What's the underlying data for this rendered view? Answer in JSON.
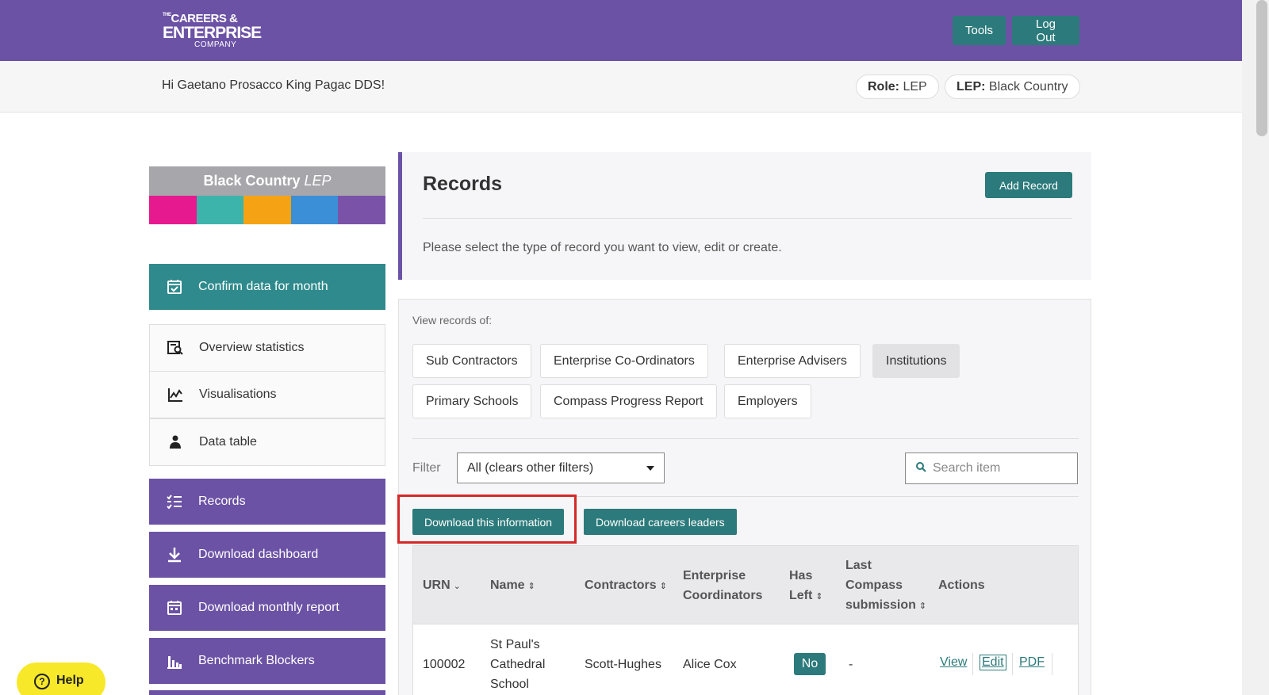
{
  "header": {
    "logo": {
      "the": "THE",
      "line1": "CAREERS &",
      "line2": "ENTERPRISE",
      "line3": "COMPANY"
    },
    "tools_label": "Tools",
    "logout_label": "Log Out"
  },
  "subheader": {
    "greeting": "Hi Gaetano Prosacco King Pagac DDS!",
    "role_key": "Role:",
    "role_value": "LEP",
    "lep_key": "LEP:",
    "lep_value": "Black Country"
  },
  "sidebar": {
    "lep_logo": {
      "name": "Black Country",
      "suffix": "LEP",
      "stripe_colors": [
        "#e6198f",
        "#3cb4ac",
        "#f5a314",
        "#3b8fd6",
        "#7a53a8"
      ]
    },
    "confirm_label": "Confirm data for month",
    "items": [
      {
        "label": "Overview statistics",
        "icon": "overview-stats-icon"
      },
      {
        "label": "Visualisations",
        "icon": "chart-icon"
      },
      {
        "label": "Data table",
        "icon": "person-table-icon"
      }
    ],
    "purple_items": [
      {
        "label": "Records",
        "icon": "list-check-icon"
      },
      {
        "label": "Download dashboard",
        "icon": "download-icon"
      },
      {
        "label": "Download monthly report",
        "icon": "calendar-icon"
      },
      {
        "label": "Benchmark Blockers",
        "icon": "bar-chart-icon"
      }
    ]
  },
  "records_panel": {
    "title": "Records",
    "add_label": "Add Record",
    "description": "Please select the type of record you want to view, edit or create."
  },
  "view_panel": {
    "view_of_label": "View records of:",
    "types": [
      "Sub Contractors",
      "Enterprise Co-Ordinators",
      "Enterprise Advisers",
      "Institutions",
      "Primary Schools",
      "Compass Progress Report",
      "Employers"
    ],
    "active_type": "Institutions",
    "filter_label": "Filter",
    "filter_value": "All (clears other filters)",
    "search_placeholder": "Search item",
    "download_info_label": "Download this information",
    "download_leaders_label": "Download careers leaders"
  },
  "table": {
    "headers": {
      "urn": "URN",
      "name": "Name",
      "contractors": "Contractors",
      "coord_1": "Enterprise",
      "coord_2": "Coordinators",
      "hasleft_1": "Has",
      "hasleft_2": "Left",
      "compass_1": "Last",
      "compass_2": "Compass",
      "compass_3": "submission",
      "actions": "Actions"
    },
    "rows": [
      {
        "urn": "100002",
        "name_1": "St Paul's",
        "name_2": "Cathedral",
        "name_3": "School",
        "contractors": "Scott-Hughes",
        "coordinator": "Alice Cox",
        "has_left": "No",
        "last_compass": "-",
        "view": "View",
        "edit": "Edit",
        "pdf": "PDF"
      }
    ]
  },
  "help_label": "Help",
  "colors": {
    "purple": "#6b52a5",
    "teal": "#2c7a7b",
    "highlight": "#d62828",
    "help": "#f7e92a"
  }
}
